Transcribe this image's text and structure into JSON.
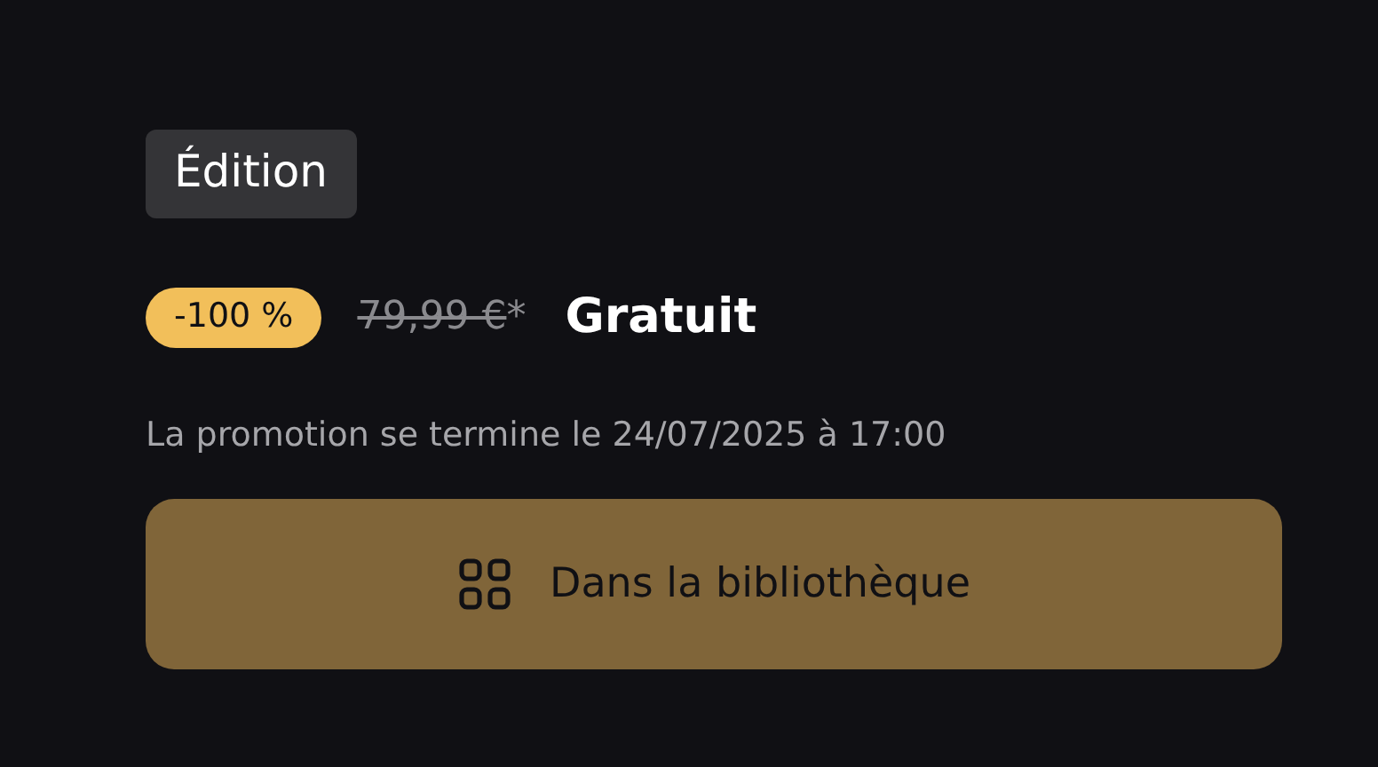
{
  "edition_tag": "Édition",
  "price": {
    "discount": "-100 %",
    "original": "79,99 €",
    "original_mark": "*",
    "current": "Gratuit"
  },
  "promo_end": "La promotion se termine le 24/07/2025 à 17:00",
  "library_button": {
    "label": "Dans la bibliothèque",
    "disabled": true
  }
}
